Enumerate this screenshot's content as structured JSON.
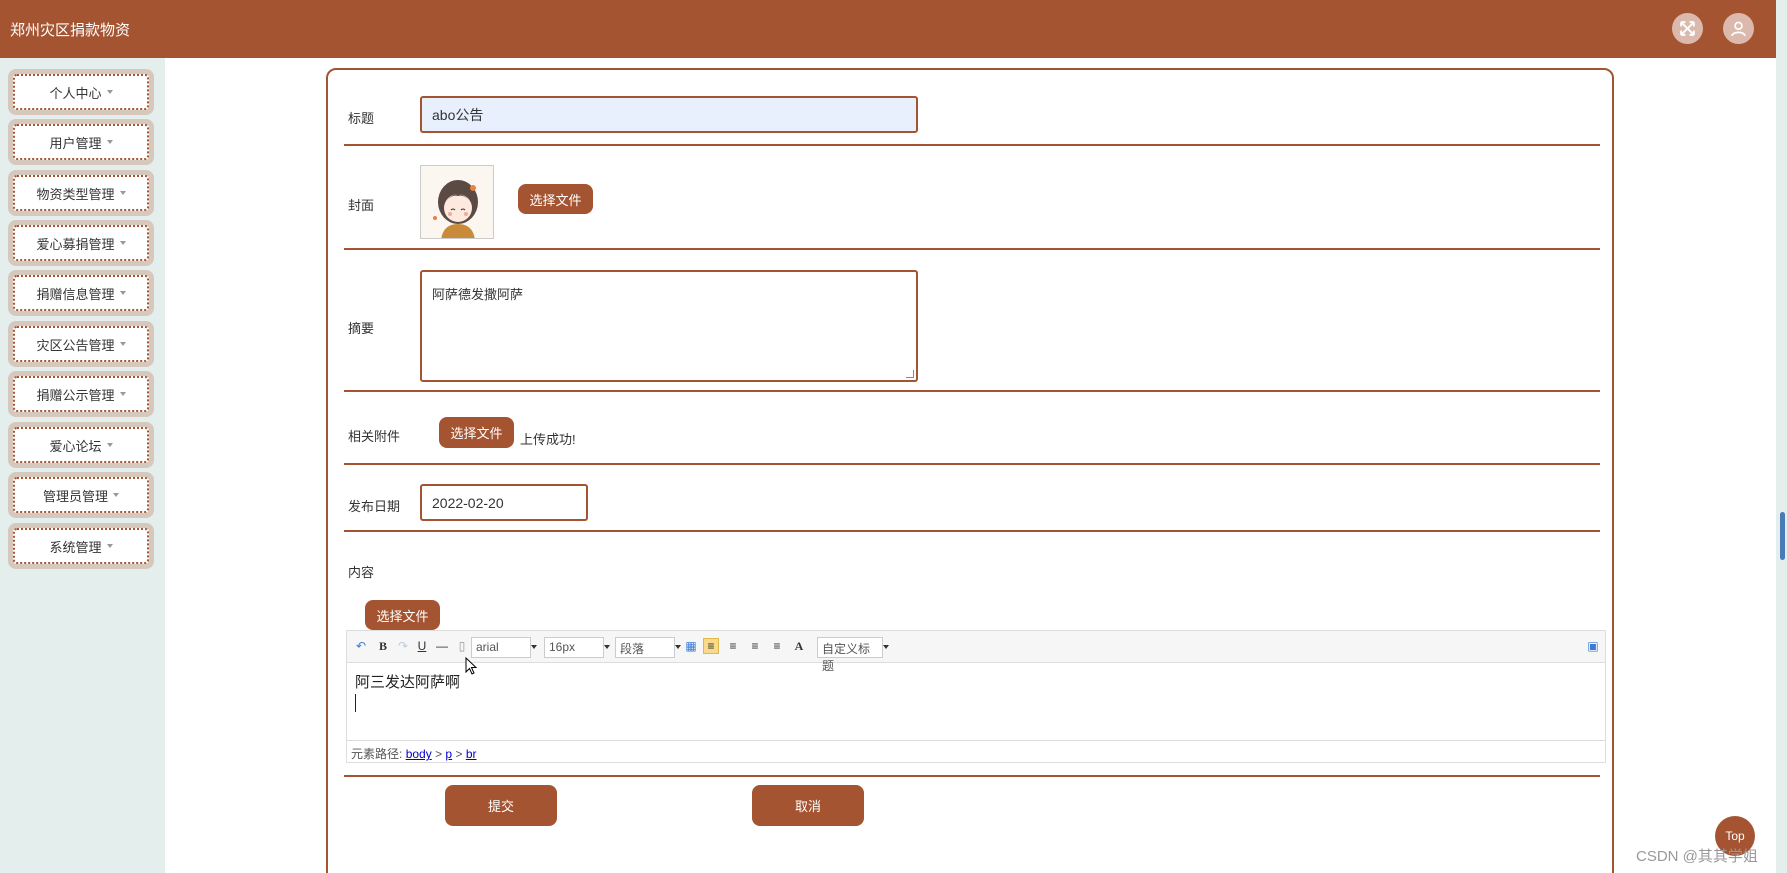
{
  "app": {
    "title": "郑州灾区捐款物资"
  },
  "header": {
    "fullscreen_icon": "fullscreen-icon",
    "user_icon": "user-icon"
  },
  "sidebar": {
    "items": [
      {
        "label": "个人中心"
      },
      {
        "label": "用户管理"
      },
      {
        "label": "物资类型管理"
      },
      {
        "label": "爱心募捐管理"
      },
      {
        "label": "捐赠信息管理"
      },
      {
        "label": "灾区公告管理"
      },
      {
        "label": "捐赠公示管理"
      },
      {
        "label": "爱心论坛"
      },
      {
        "label": "管理员管理"
      },
      {
        "label": "系统管理"
      }
    ]
  },
  "form": {
    "title_label": "标题",
    "title_value": "abo公告",
    "cover_label": "封面",
    "cover_button": "选择文件",
    "summary_label": "摘要",
    "summary_value": "阿萨德发撒阿萨",
    "attachment_label": "相关附件",
    "attachment_button": "选择文件",
    "attachment_status": "上传成功!",
    "date_label": "发布日期",
    "date_value": "2022-02-20",
    "content_label": "内容",
    "content_button": "选择文件",
    "editor": {
      "font_family": "arial",
      "font_size": "16px",
      "paragraph": "段落",
      "custom_title": "自定义标题",
      "body_text": "阿三发达阿萨啊",
      "path_prefix": "元素路径:",
      "path_body": "body",
      "path_p": "p",
      "path_br": "br",
      "path_sep1": ">",
      "path_sep2": ">"
    },
    "submit_button": "提交",
    "cancel_button": "取消"
  },
  "misc": {
    "top_button": "Top",
    "watermark": "CSDN @其其学姐"
  },
  "colors": {
    "brand": "#a55432",
    "sidebar_bg": "#e4eeec"
  }
}
